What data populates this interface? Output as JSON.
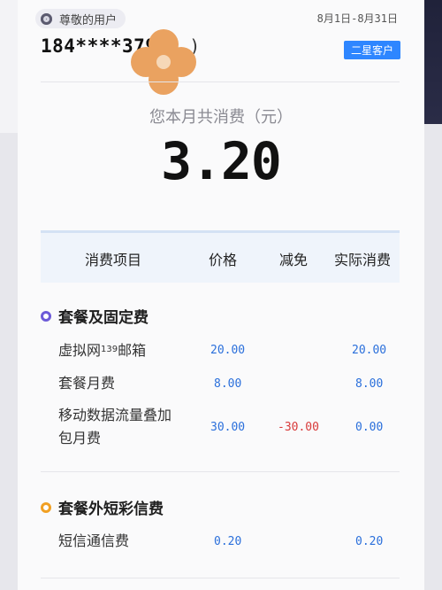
{
  "header": {
    "user_label": "尊敬的用户",
    "date_range": "8月1日-8月31日",
    "phone": "184****379",
    "phone_paren": ")",
    "tier": "二星客户"
  },
  "summary": {
    "label": "您本月共消费（元）",
    "amount": "3.20"
  },
  "table": {
    "headers": [
      "消费项目",
      "价格",
      "减免",
      "实际消费"
    ]
  },
  "sections": [
    {
      "title": "套餐及固定费",
      "rows": [
        {
          "item_a": "虚拟网",
          "item_sup": "139",
          "item_b": "邮箱",
          "price": "20.00",
          "discount": "",
          "actual": "20.00"
        },
        {
          "item": "套餐月费",
          "price": "8.00",
          "discount": "",
          "actual": "8.00"
        },
        {
          "item_line1": "移动数据流量叠加",
          "item_line2": "包月费",
          "price": "30.00",
          "discount": "-30.00",
          "actual": "0.00"
        }
      ]
    },
    {
      "title": "套餐外短彩信费",
      "rows": [
        {
          "item": "短信通信费",
          "price": "0.20",
          "discount": "",
          "actual": "0.20"
        }
      ]
    }
  ],
  "colors": {
    "accent_blue": "#2e86ff",
    "number_blue": "#2a6fdb",
    "discount_red": "#d83a3a",
    "dot_purple": "#6c5ad8",
    "dot_orange": "#f1a023",
    "redaction_orange": "#eaa260"
  }
}
